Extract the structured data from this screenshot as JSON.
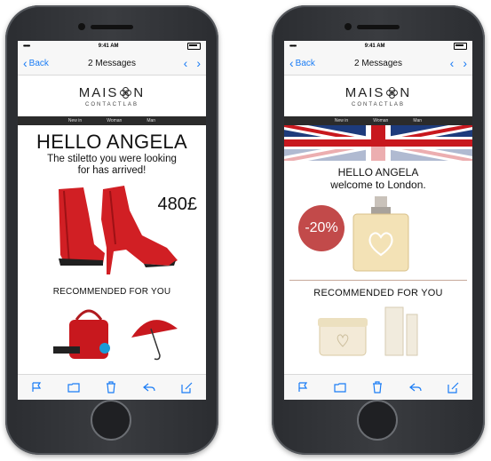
{
  "status": {
    "time": "9:41 AM",
    "signal": "•••••"
  },
  "nav": {
    "back": "Back",
    "title": "2 Messages"
  },
  "brand": {
    "name_left": "MAIS",
    "name_right": "N",
    "sub": "CONTACTLAB"
  },
  "menu": [
    "New in",
    "Woman",
    "Man"
  ],
  "left_email": {
    "headline": "HELLO ANGELA",
    "message": "The stiletto you were looking for has arrived!",
    "price": "480£",
    "recommended": "RECOMMENDED FOR YOU"
  },
  "right_email": {
    "headline": "HELLO ANGELA",
    "subline": "welcome to London.",
    "discount": "-20%",
    "recommended": "RECOMMENDED FOR YOU"
  },
  "colors": {
    "accent": "#1a7cf5",
    "red": "#d11f24",
    "badge": "#c24a4a"
  },
  "icons": [
    "flag-icon",
    "folder-icon",
    "trash-icon",
    "reply-icon",
    "compose-icon"
  ]
}
